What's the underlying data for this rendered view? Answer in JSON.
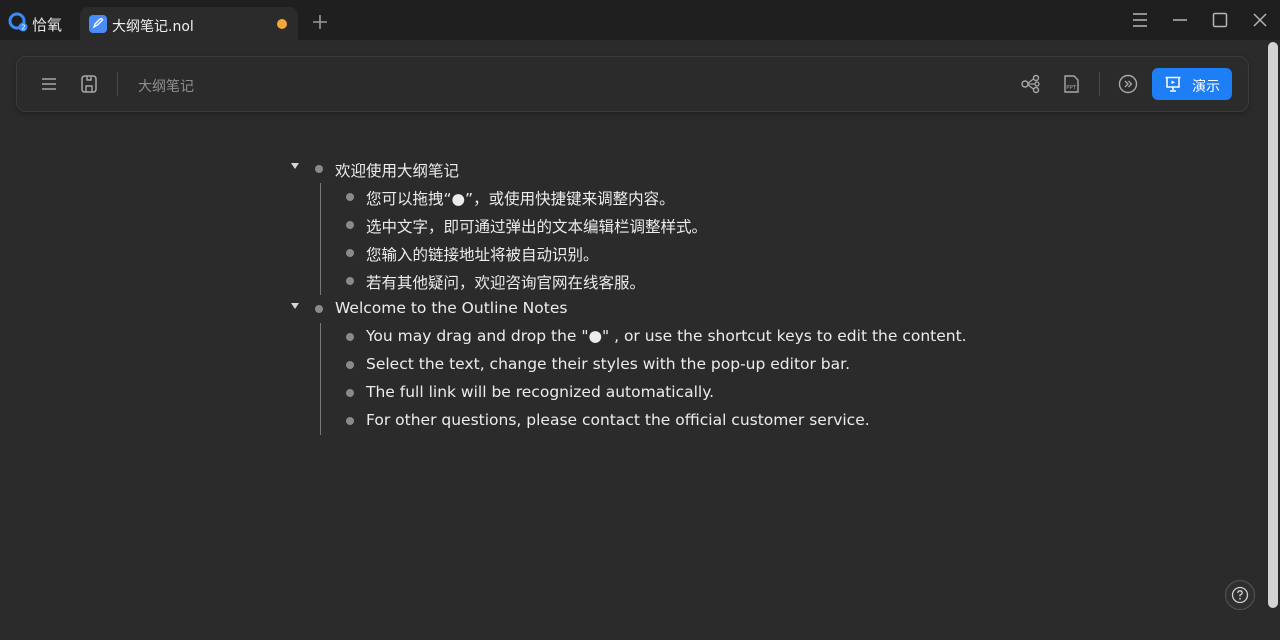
{
  "app": {
    "name": "恰氧",
    "logo_icon": "app-logo-icon"
  },
  "tab": {
    "title": "大纲笔记.nol",
    "unsaved_color": "#f2a93b"
  },
  "window_controls": [
    "menu-icon",
    "minimize-icon",
    "maximize-icon",
    "close-icon"
  ],
  "toolbar": {
    "doc_title": "大纲笔记",
    "present_label": "演示",
    "accent": "#1e7ef6"
  },
  "outline": [
    {
      "text": "欢迎使用大纲笔记",
      "children": [
        "您可以拖拽“●”，或使用快捷键来调整内容。",
        "选中文字，即可通过弹出的文本编辑栏调整样式。",
        "您输入的链接地址将被自动识别。",
        "若有其他疑问，欢迎咨询官网在线客服。"
      ]
    },
    {
      "text": "Welcome to the Outline Notes",
      "children": [
        "You may drag and drop the \"●\" , or use the shortcut keys to edit the content.",
        "Select the text, change their styles with the pop-up editor bar.",
        "The full link will be recognized automatically.",
        "For other questions, please contact the official customer service."
      ]
    }
  ]
}
